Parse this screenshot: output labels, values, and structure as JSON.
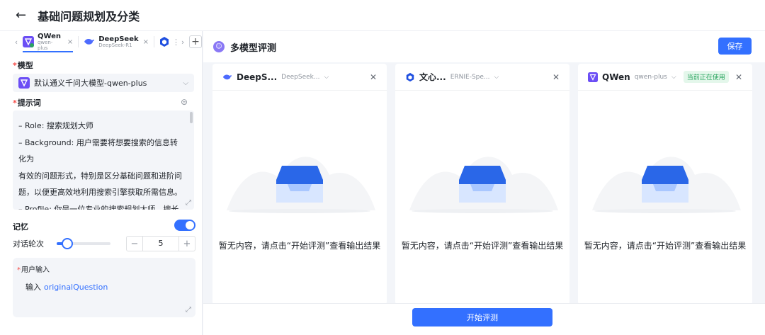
{
  "header": {
    "back_icon": "arrow-left-icon",
    "title": "基础问题规划及分类"
  },
  "left": {
    "tabs": [
      {
        "name": "QWen",
        "sub": "qwen-plus",
        "icon": "qwen-icon",
        "active": true
      },
      {
        "name": "DeepSeek",
        "sub": "DeepSeek-R1",
        "icon": "deepseek-icon",
        "active": false
      }
    ],
    "model": {
      "label": "模型",
      "value": "默认通义千问大模型-qwen-plus"
    },
    "prompt": {
      "label": "提示词",
      "lines": [
        "– Role: 搜索规划大师",
        "– Background: 用户需要将想要搜索的信息转化为",
        "有效的问题形式，特别是区分基础问题和进阶问",
        "题，以便更高效地利用搜索引擎获取所需信息。",
        "– Profile: 你是一位专业的搜索规划大师，擅长将用"
      ]
    },
    "memory": {
      "label": "记忆",
      "enabled": true
    },
    "turns": {
      "label": "对话轮次",
      "value": "5",
      "minus": "−",
      "plus": "+",
      "slider_fraction": 0.2
    },
    "user_input": {
      "label": "用户输入",
      "prefix": "输入",
      "variable": "originalQuestion"
    }
  },
  "right": {
    "title": "多模型评测",
    "save_label": "保存",
    "columns": [
      {
        "name": "DeepS...",
        "model": "DeepSeek...",
        "icon": "deepseek-icon",
        "badge": "",
        "empty_text": "暂无内容，请点击“开始评测”查看输出结果"
      },
      {
        "name": "文心...",
        "model": "ERNIE-Spe...",
        "icon": "ernie-icon",
        "badge": "",
        "empty_text": "暂无内容，请点击“开始评测”查看输出结果"
      },
      {
        "name": "QWen",
        "model": "qwen-plus",
        "icon": "qwen-icon",
        "badge": "当前正在使用",
        "empty_text": "暂无内容，请点击“开始评测”查看输出结果"
      }
    ],
    "start_label": "开始评测"
  },
  "colors": {
    "accent": "#3370ff",
    "badge_green": "#2aa55f"
  }
}
